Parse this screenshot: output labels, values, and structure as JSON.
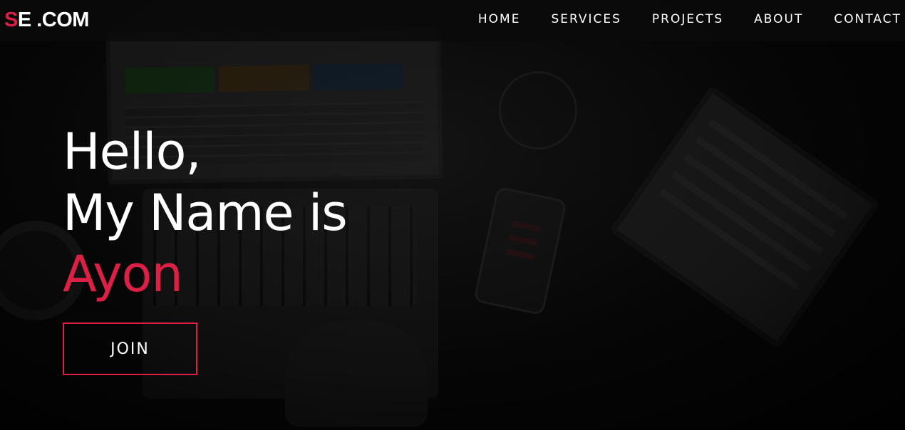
{
  "brand": {
    "logo_accent": "S",
    "logo_rest": "E .COM",
    "accent_color": "#dc1f44"
  },
  "nav": {
    "items": [
      {
        "label": "HOME"
      },
      {
        "label": "SERVICES"
      },
      {
        "label": "PROJECTS"
      },
      {
        "label": "ABOUT"
      },
      {
        "label": "CONTACT"
      }
    ]
  },
  "hero": {
    "line1": "Hello,",
    "line2": "My Name is",
    "name": "Ayon",
    "cta_label": "JOIN"
  }
}
